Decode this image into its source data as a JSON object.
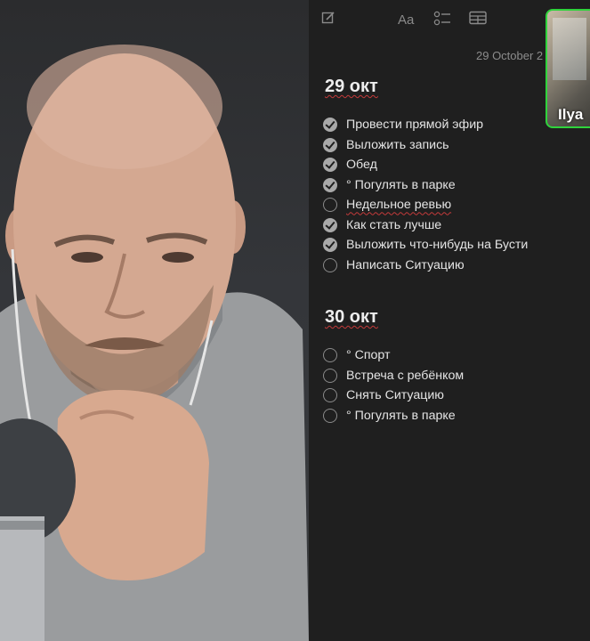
{
  "notes": {
    "toolbar": {
      "format_label": "Aa",
      "compose_icon": "compose-icon",
      "checklist_icon": "checklist-icon",
      "table_icon": "table-icon"
    },
    "date_line": "29 October 2",
    "sections": [
      {
        "heading": "29 окт",
        "items": [
          {
            "text": "Провести прямой эфир",
            "checked": true
          },
          {
            "text": "Выложить запись",
            "checked": true
          },
          {
            "text": "Обед",
            "checked": true
          },
          {
            "text": "° Погулять в парке",
            "checked": true
          },
          {
            "text": "Недельное ревью",
            "checked": false
          },
          {
            "text": "Как стать лучше",
            "checked": true
          },
          {
            "text": "Выложить что-нибудь на Бусти",
            "checked": true
          },
          {
            "text": "Написать Ситуацию",
            "checked": false
          }
        ]
      },
      {
        "heading": "30 окт",
        "items": [
          {
            "text": "° Спорт",
            "checked": false
          },
          {
            "text": "Встреча с ребёнком",
            "checked": false
          },
          {
            "text": "Снять Ситуацию",
            "checked": false
          },
          {
            "text": "° Погулять в парке",
            "checked": false
          }
        ]
      }
    ]
  },
  "participant": {
    "name": "Ilya",
    "border_color": "#2fd33c"
  },
  "colors": {
    "notes_bg": "#1f1f1f",
    "check_done": "#a9a9a9",
    "spell_underline": "#c43a3a"
  }
}
